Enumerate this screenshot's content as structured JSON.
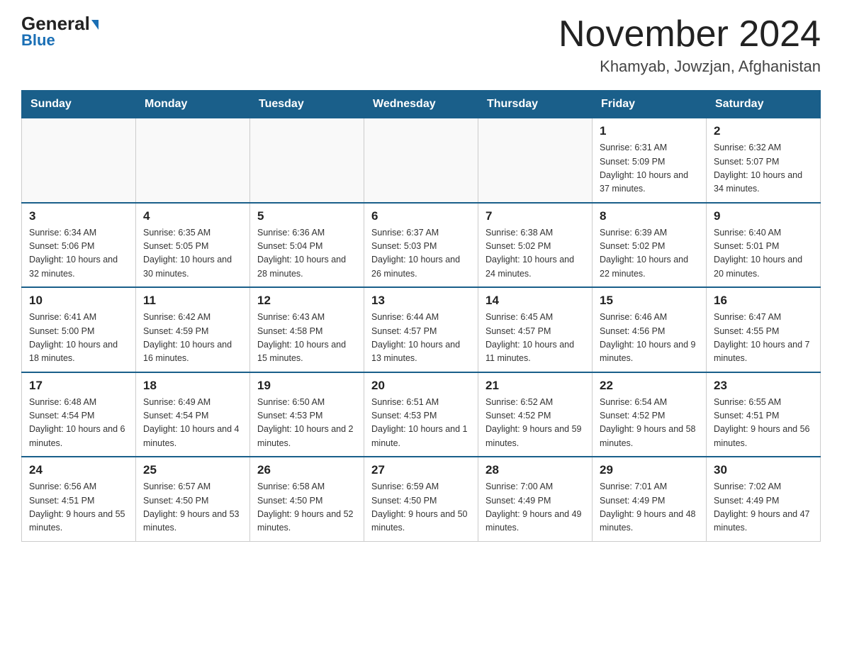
{
  "header": {
    "logo_general": "General",
    "logo_blue": "Blue",
    "month_year": "November 2024",
    "location": "Khamyab, Jowzjan, Afghanistan"
  },
  "days_of_week": [
    "Sunday",
    "Monday",
    "Tuesday",
    "Wednesday",
    "Thursday",
    "Friday",
    "Saturday"
  ],
  "weeks": [
    [
      {
        "day": "",
        "info": ""
      },
      {
        "day": "",
        "info": ""
      },
      {
        "day": "",
        "info": ""
      },
      {
        "day": "",
        "info": ""
      },
      {
        "day": "",
        "info": ""
      },
      {
        "day": "1",
        "info": "Sunrise: 6:31 AM\nSunset: 5:09 PM\nDaylight: 10 hours and 37 minutes."
      },
      {
        "day": "2",
        "info": "Sunrise: 6:32 AM\nSunset: 5:07 PM\nDaylight: 10 hours and 34 minutes."
      }
    ],
    [
      {
        "day": "3",
        "info": "Sunrise: 6:34 AM\nSunset: 5:06 PM\nDaylight: 10 hours and 32 minutes."
      },
      {
        "day": "4",
        "info": "Sunrise: 6:35 AM\nSunset: 5:05 PM\nDaylight: 10 hours and 30 minutes."
      },
      {
        "day": "5",
        "info": "Sunrise: 6:36 AM\nSunset: 5:04 PM\nDaylight: 10 hours and 28 minutes."
      },
      {
        "day": "6",
        "info": "Sunrise: 6:37 AM\nSunset: 5:03 PM\nDaylight: 10 hours and 26 minutes."
      },
      {
        "day": "7",
        "info": "Sunrise: 6:38 AM\nSunset: 5:02 PM\nDaylight: 10 hours and 24 minutes."
      },
      {
        "day": "8",
        "info": "Sunrise: 6:39 AM\nSunset: 5:02 PM\nDaylight: 10 hours and 22 minutes."
      },
      {
        "day": "9",
        "info": "Sunrise: 6:40 AM\nSunset: 5:01 PM\nDaylight: 10 hours and 20 minutes."
      }
    ],
    [
      {
        "day": "10",
        "info": "Sunrise: 6:41 AM\nSunset: 5:00 PM\nDaylight: 10 hours and 18 minutes."
      },
      {
        "day": "11",
        "info": "Sunrise: 6:42 AM\nSunset: 4:59 PM\nDaylight: 10 hours and 16 minutes."
      },
      {
        "day": "12",
        "info": "Sunrise: 6:43 AM\nSunset: 4:58 PM\nDaylight: 10 hours and 15 minutes."
      },
      {
        "day": "13",
        "info": "Sunrise: 6:44 AM\nSunset: 4:57 PM\nDaylight: 10 hours and 13 minutes."
      },
      {
        "day": "14",
        "info": "Sunrise: 6:45 AM\nSunset: 4:57 PM\nDaylight: 10 hours and 11 minutes."
      },
      {
        "day": "15",
        "info": "Sunrise: 6:46 AM\nSunset: 4:56 PM\nDaylight: 10 hours and 9 minutes."
      },
      {
        "day": "16",
        "info": "Sunrise: 6:47 AM\nSunset: 4:55 PM\nDaylight: 10 hours and 7 minutes."
      }
    ],
    [
      {
        "day": "17",
        "info": "Sunrise: 6:48 AM\nSunset: 4:54 PM\nDaylight: 10 hours and 6 minutes."
      },
      {
        "day": "18",
        "info": "Sunrise: 6:49 AM\nSunset: 4:54 PM\nDaylight: 10 hours and 4 minutes."
      },
      {
        "day": "19",
        "info": "Sunrise: 6:50 AM\nSunset: 4:53 PM\nDaylight: 10 hours and 2 minutes."
      },
      {
        "day": "20",
        "info": "Sunrise: 6:51 AM\nSunset: 4:53 PM\nDaylight: 10 hours and 1 minute."
      },
      {
        "day": "21",
        "info": "Sunrise: 6:52 AM\nSunset: 4:52 PM\nDaylight: 9 hours and 59 minutes."
      },
      {
        "day": "22",
        "info": "Sunrise: 6:54 AM\nSunset: 4:52 PM\nDaylight: 9 hours and 58 minutes."
      },
      {
        "day": "23",
        "info": "Sunrise: 6:55 AM\nSunset: 4:51 PM\nDaylight: 9 hours and 56 minutes."
      }
    ],
    [
      {
        "day": "24",
        "info": "Sunrise: 6:56 AM\nSunset: 4:51 PM\nDaylight: 9 hours and 55 minutes."
      },
      {
        "day": "25",
        "info": "Sunrise: 6:57 AM\nSunset: 4:50 PM\nDaylight: 9 hours and 53 minutes."
      },
      {
        "day": "26",
        "info": "Sunrise: 6:58 AM\nSunset: 4:50 PM\nDaylight: 9 hours and 52 minutes."
      },
      {
        "day": "27",
        "info": "Sunrise: 6:59 AM\nSunset: 4:50 PM\nDaylight: 9 hours and 50 minutes."
      },
      {
        "day": "28",
        "info": "Sunrise: 7:00 AM\nSunset: 4:49 PM\nDaylight: 9 hours and 49 minutes."
      },
      {
        "day": "29",
        "info": "Sunrise: 7:01 AM\nSunset: 4:49 PM\nDaylight: 9 hours and 48 minutes."
      },
      {
        "day": "30",
        "info": "Sunrise: 7:02 AM\nSunset: 4:49 PM\nDaylight: 9 hours and 47 minutes."
      }
    ]
  ]
}
